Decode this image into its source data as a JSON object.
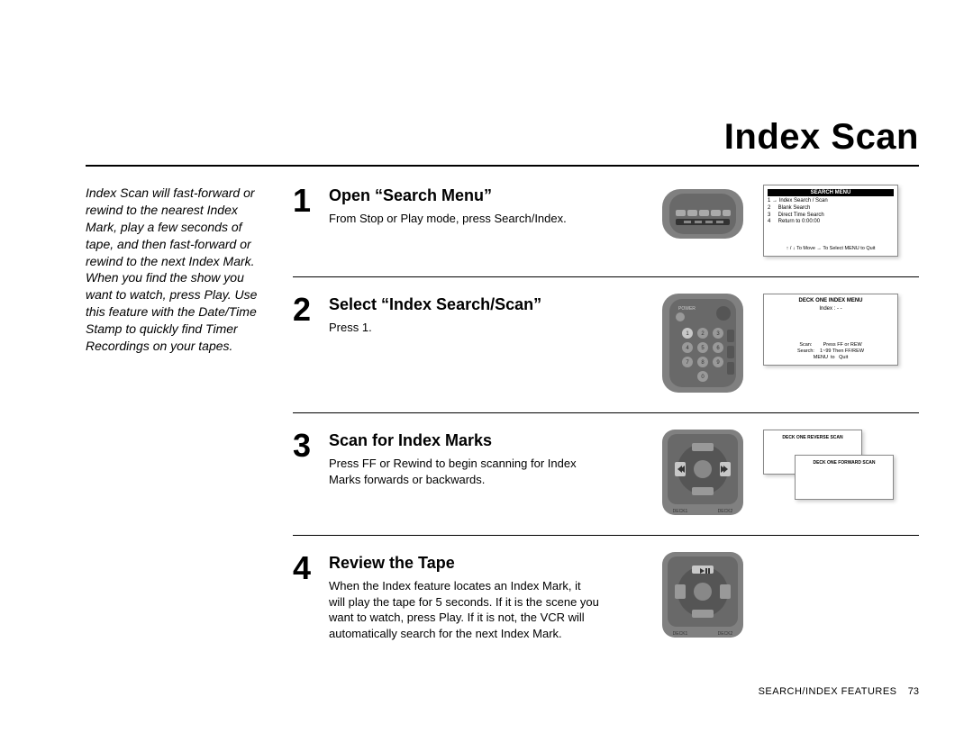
{
  "title": "Index Scan",
  "intro": "Index Scan will fast-forward or rewind to the nearest Index Mark, play a few seconds of tape, and then fast-forward or rewind to the next Index Mark. When you find the show you want to watch, press Play. Use this feature with the Date/Time Stamp to quickly find Timer Recordings on your tapes.",
  "steps": [
    {
      "num": "1",
      "heading": "Open “Search Menu”",
      "text": "From Stop or Play mode, press Search/Index.",
      "screen": {
        "title": "SEARCH MENU",
        "lines": [
          "1 → Index Search / Scan",
          "2     Blank Search",
          "3     Direct Time Search",
          "4     Return to 0:00:00"
        ],
        "footer": "↑ / ↓  To Move        → To Select\nMENU to Quit"
      }
    },
    {
      "num": "2",
      "heading": "Select “Index Search/Scan”",
      "text": "Press 1.",
      "screen": {
        "title": "DECK ONE INDEX MENU",
        "lines": [
          "Index  :  - -"
        ],
        "footer": "Scan:        Press FF or REW\nSearch:    1~99 Then FF/REW\nMENU  to   Quit"
      }
    },
    {
      "num": "3",
      "heading": "Scan for Index Marks",
      "text": "Press FF or Rewind to begin scanning for Index Marks forwards or backwards.",
      "stack": {
        "a": "DECK ONE REVERSE SCAN",
        "b": "DECK ONE FORWARD SCAN"
      }
    },
    {
      "num": "4",
      "heading": "Review the Tape",
      "text": "When the Index feature locates an Index Mark, it will play the tape for 5 seconds. If it is the scene you want to watch, press Play. If it is not, the VCR will automatically search for the next Index Mark."
    }
  ],
  "footer": {
    "label": "SEARCH/INDEX FEATURES",
    "page": "73"
  },
  "remote_labels": {
    "deck1": "DECK1",
    "deck2": "DECK2",
    "power": "POWER"
  }
}
